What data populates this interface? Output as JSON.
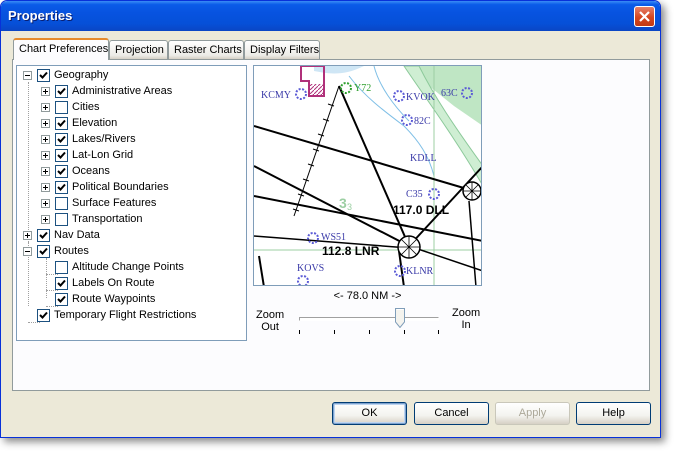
{
  "window": {
    "title": "Properties"
  },
  "tabs": [
    {
      "label": "Chart Preferences",
      "active": true
    },
    {
      "label": "Projection",
      "active": false
    },
    {
      "label": "Raster Charts",
      "active": false
    },
    {
      "label": "Display Filters",
      "active": false
    }
  ],
  "tree": {
    "items": [
      {
        "label": "Geography",
        "checked": true,
        "expander": "minus",
        "level": 0
      },
      {
        "label": "Administrative Areas",
        "checked": true,
        "expander": "plus",
        "level": 1
      },
      {
        "label": "Cities",
        "checked": false,
        "expander": "plus",
        "level": 1
      },
      {
        "label": "Elevation",
        "checked": true,
        "expander": "plus",
        "level": 1
      },
      {
        "label": "Lakes/Rivers",
        "checked": true,
        "expander": "plus",
        "level": 1
      },
      {
        "label": "Lat-Lon Grid",
        "checked": true,
        "expander": "plus",
        "level": 1
      },
      {
        "label": "Oceans",
        "checked": true,
        "expander": "plus",
        "level": 1
      },
      {
        "label": "Political Boundaries",
        "checked": true,
        "expander": "plus",
        "level": 1
      },
      {
        "label": "Surface Features",
        "checked": false,
        "expander": "plus",
        "level": 1
      },
      {
        "label": "Transportation",
        "checked": false,
        "expander": "plus",
        "level": 1
      },
      {
        "label": "Nav Data",
        "checked": true,
        "expander": "plus",
        "level": 0
      },
      {
        "label": "Routes",
        "checked": true,
        "expander": "minus",
        "level": 0
      },
      {
        "label": "Altitude Change Points",
        "checked": false,
        "expander": "none",
        "level": 1
      },
      {
        "label": "Labels On Route",
        "checked": true,
        "expander": "none",
        "level": 1
      },
      {
        "label": "Route Waypoints",
        "checked": true,
        "expander": "none",
        "level": 1
      },
      {
        "label": "Temporary Flight Restrictions",
        "checked": true,
        "expander": "none",
        "level": 0
      }
    ]
  },
  "map": {
    "labels": {
      "kcmy": "KCMY",
      "y72": "Y72",
      "kvok": "KVOK",
      "c63": "63C",
      "c82": "82C",
      "kdll": "KDLL",
      "c35": "C35",
      "dll_freq": "117.0 DLL",
      "ws51": "WS51",
      "lnr_freq": "112.8 LNR",
      "kovs": "KOVS",
      "klnr": "KLNR"
    },
    "range_label": "<-  78.0 NM  ->",
    "colors": {
      "airport": "#5b5bd6",
      "water": "#a8d8f0",
      "vegetation": "#9fd6a6",
      "restricted": "#b0307a",
      "route": "#000000"
    }
  },
  "zoom": {
    "out_label": "Zoom\nOut",
    "in_label": "Zoom\nIn",
    "value_fraction": 0.72
  },
  "buttons": {
    "ok": "OK",
    "cancel": "Cancel",
    "apply": "Apply",
    "help": "Help"
  },
  "icons": {
    "close": "close-icon",
    "check": "checkmark-icon",
    "airport": "airport-icon",
    "vor": "vor-compass-icon"
  }
}
